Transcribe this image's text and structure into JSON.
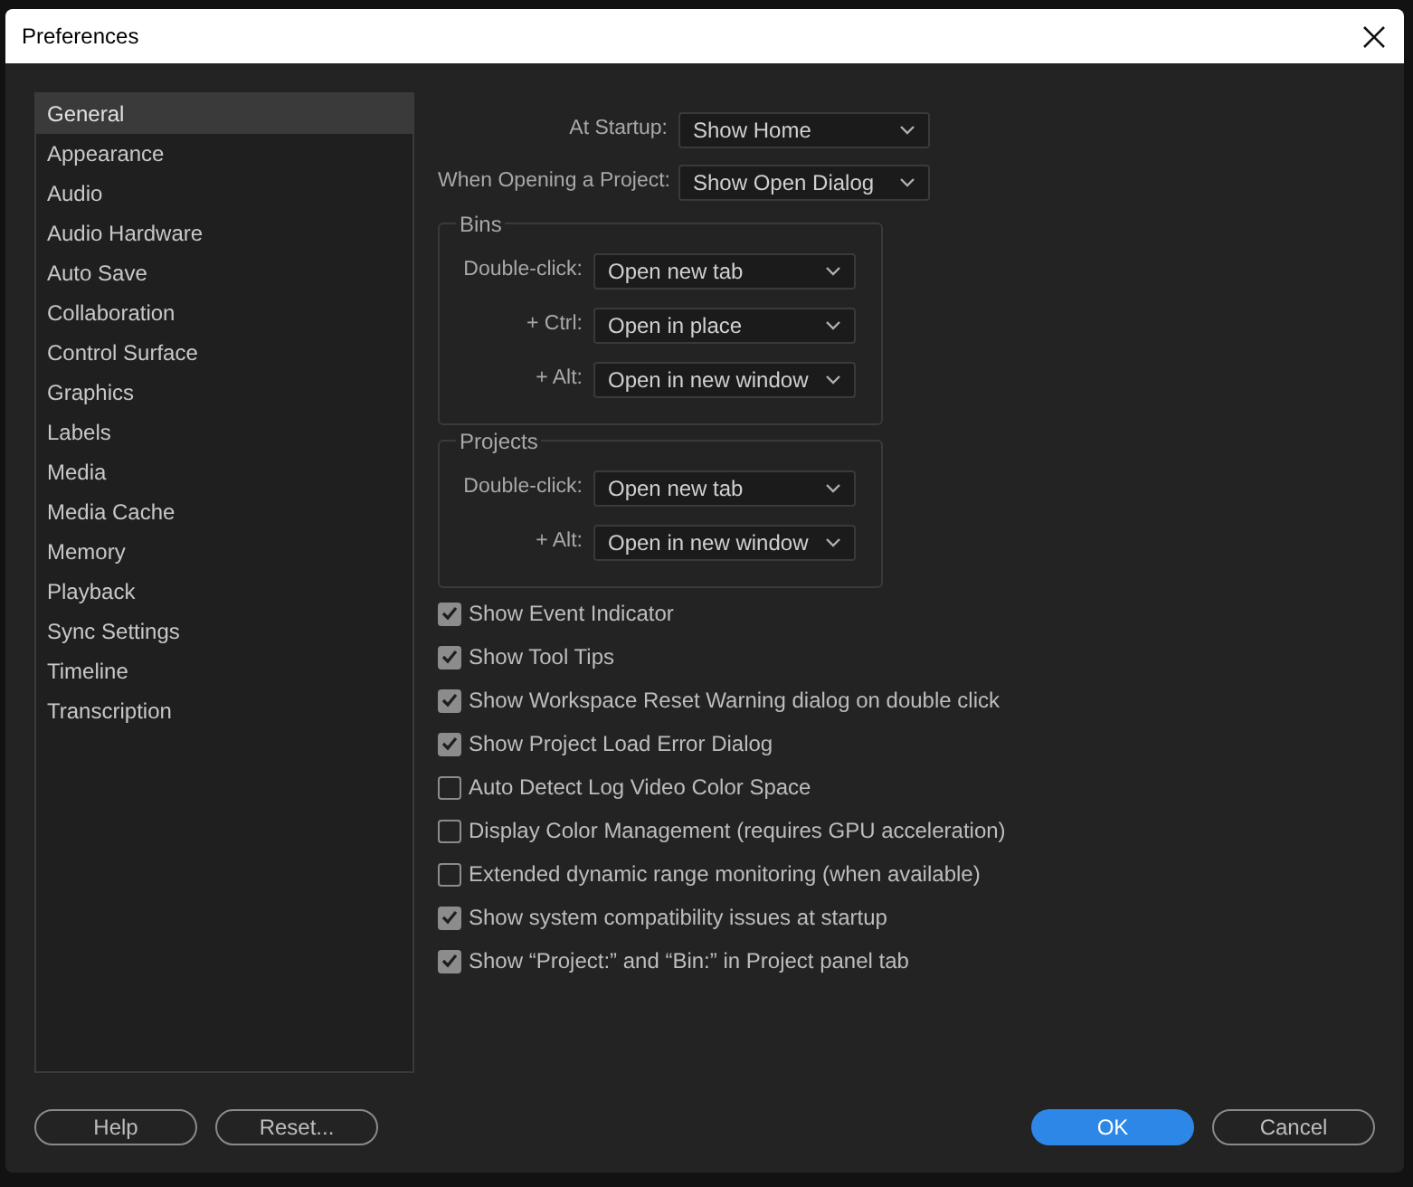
{
  "window": {
    "title": "Preferences"
  },
  "sidebar": {
    "items": [
      {
        "label": "General",
        "selected": true
      },
      {
        "label": "Appearance",
        "selected": false
      },
      {
        "label": "Audio",
        "selected": false
      },
      {
        "label": "Audio Hardware",
        "selected": false
      },
      {
        "label": "Auto Save",
        "selected": false
      },
      {
        "label": "Collaboration",
        "selected": false
      },
      {
        "label": "Control Surface",
        "selected": false
      },
      {
        "label": "Graphics",
        "selected": false
      },
      {
        "label": "Labels",
        "selected": false
      },
      {
        "label": "Media",
        "selected": false
      },
      {
        "label": "Media Cache",
        "selected": false
      },
      {
        "label": "Memory",
        "selected": false
      },
      {
        "label": "Playback",
        "selected": false
      },
      {
        "label": "Sync Settings",
        "selected": false
      },
      {
        "label": "Timeline",
        "selected": false
      },
      {
        "label": "Transcription",
        "selected": false
      }
    ]
  },
  "fields": [
    {
      "label": "At Startup:",
      "value": "Show Home"
    },
    {
      "label": "When Opening a Project:",
      "value": "Show Open Dialog"
    }
  ],
  "groups": [
    {
      "title": "Bins",
      "fields": [
        {
          "label": "Double-click:",
          "value": "Open new tab"
        },
        {
          "label": "+ Ctrl:",
          "value": "Open in place"
        },
        {
          "label": "+ Alt:",
          "value": "Open in new window"
        }
      ]
    },
    {
      "title": "Projects",
      "fields": [
        {
          "label": "Double-click:",
          "value": "Open new tab"
        },
        {
          "label": "+ Alt:",
          "value": "Open in new window"
        }
      ]
    }
  ],
  "checkboxes": [
    {
      "label": "Show Event Indicator",
      "checked": true
    },
    {
      "label": "Show Tool Tips",
      "checked": true
    },
    {
      "label": "Show Workspace Reset Warning dialog on double click",
      "checked": true
    },
    {
      "label": "Show Project Load Error Dialog",
      "checked": true
    },
    {
      "label": "Auto Detect Log Video Color Space",
      "checked": false
    },
    {
      "label": "Display Color Management (requires GPU acceleration)",
      "checked": false
    },
    {
      "label": "Extended dynamic range monitoring (when available)",
      "checked": false
    },
    {
      "label": "Show system compatibility issues at startup",
      "checked": true
    },
    {
      "label": "Show “Project:” and “Bin:” in Project panel tab",
      "checked": true
    }
  ],
  "footer": {
    "left": [
      {
        "label": "Help",
        "kind": "outline"
      },
      {
        "label": "Reset...",
        "kind": "outline"
      }
    ],
    "right": [
      {
        "label": "OK",
        "kind": "primary"
      },
      {
        "label": "Cancel",
        "kind": "outline"
      }
    ]
  }
}
